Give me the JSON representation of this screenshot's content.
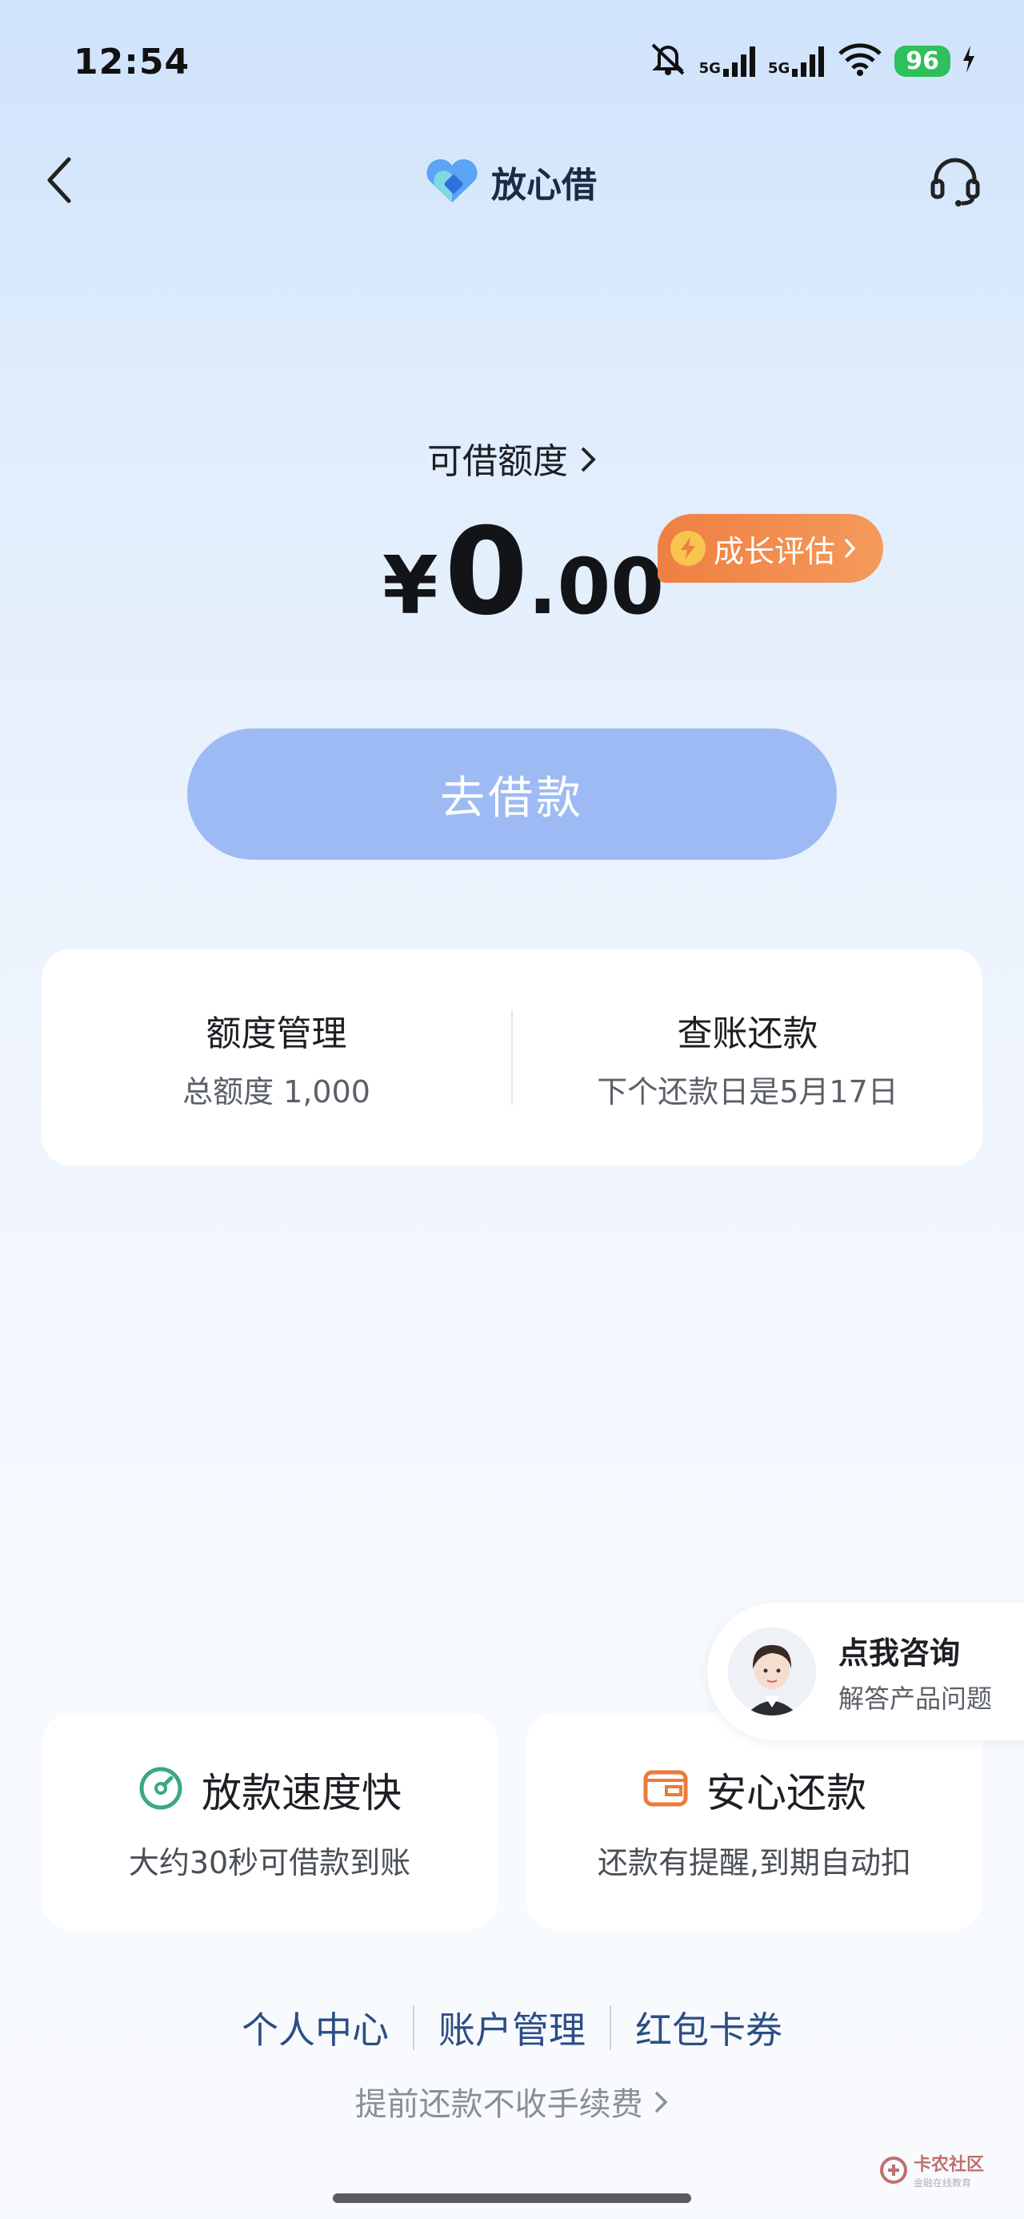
{
  "status_bar": {
    "time": "12:54",
    "network1": "5G",
    "network2": "5G",
    "battery": "96"
  },
  "nav": {
    "brand": "放心借"
  },
  "credit": {
    "label": "可借额度",
    "currency": "¥",
    "amount_int": "0",
    "amount_dec": ".00",
    "growth_label": "成长评估"
  },
  "borrow_button": "去借款",
  "summary": {
    "limit_title": "额度管理",
    "limit_sub": "总额度 1,000",
    "repay_title": "查账还款",
    "repay_sub": "下个还款日是5月17日"
  },
  "consult": {
    "title": "点我咨询",
    "subtitle": "解答产品问题"
  },
  "features": [
    {
      "title": "放款速度快",
      "desc": "大约30秒可借款到账",
      "icon": "speed-gauge-icon",
      "color": "#3aa788"
    },
    {
      "title": "安心还款",
      "desc": "还款有提醒,到期自动扣",
      "icon": "wallet-icon",
      "color": "#ee7a3a"
    }
  ],
  "links": [
    "个人中心",
    "账户管理",
    "红包卡券"
  ],
  "fee_note": "提前还款不收手续费",
  "watermark": {
    "name": "卡农社区",
    "sub": "金融在线教育"
  },
  "colors": {
    "accent_blue": "#9dbaf4",
    "growth_orange": "#ef7f43",
    "link_blue": "#2b4e85"
  }
}
